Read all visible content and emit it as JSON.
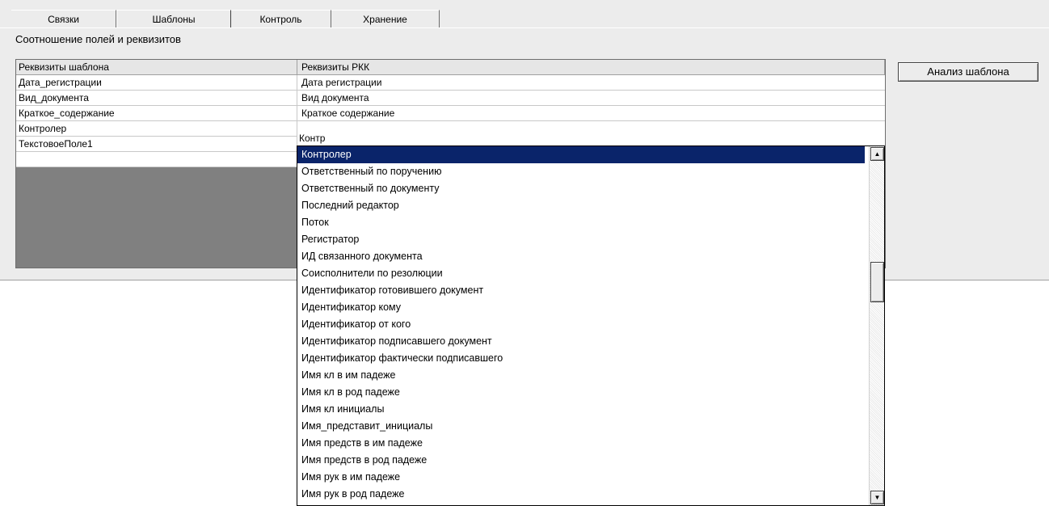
{
  "tabs": [
    {
      "label": "Связки",
      "active": false
    },
    {
      "label": "Шаблоны",
      "active": true
    },
    {
      "label": "Контроль",
      "active": false
    },
    {
      "label": "Хранение",
      "active": false
    }
  ],
  "group_title": "Соотношение полей и реквизитов",
  "grid": {
    "headers": [
      "Реквизиты шаблона",
      "Реквизиты РКК"
    ],
    "rows": [
      [
        "Дата_регистрации",
        "Дата регистрации"
      ],
      [
        "Вид_документа",
        "Вид документа"
      ],
      [
        "Краткое_содержание",
        "Краткое содержание"
      ],
      [
        "Контролер",
        "Контр"
      ],
      [
        "ТекстовоеПоле1",
        ""
      ]
    ]
  },
  "analysis_button": "Анализ шаблона",
  "combo": {
    "edit_value": "Контр",
    "items": [
      "Контролер",
      "Ответственный по поручению",
      "Ответственный по документу",
      "Последний редактор",
      "Поток",
      "Регистратор",
      "ИД связанного документа",
      "Соисполнители по резолюции",
      "Идентификатор готовившего документ",
      "Идентификатор кому",
      "Идентификатор от кого",
      "Идентификатор подписавшего документ",
      "Идентификатор фактически подписавшего",
      "Имя кл в им падеже",
      "Имя кл в род падеже",
      "Имя кл инициалы",
      "Имя_представит_инициалы",
      "Имя предств в им падеже",
      "Имя предств в род падеже",
      "Имя рук в им падеже",
      "Имя рук в род падеже"
    ],
    "selected_index": 0
  },
  "icons": {
    "scroll_up": "arrow-up-icon",
    "scroll_down": "arrow-down-icon"
  },
  "colors": {
    "selection": "#0a246a",
    "panel": "#ececec",
    "grid_empty": "#808080"
  }
}
